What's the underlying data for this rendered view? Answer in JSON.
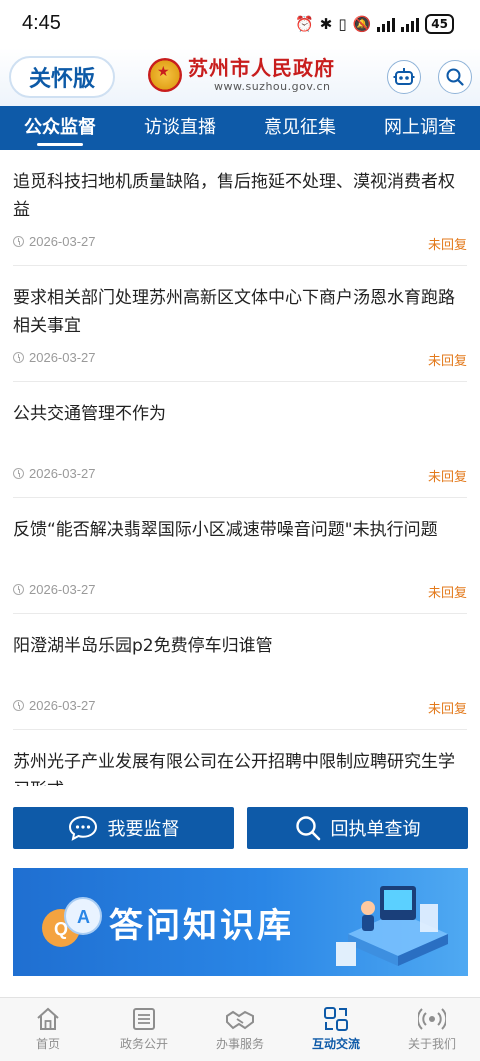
{
  "status_bar": {
    "time": "4:45",
    "battery": "45"
  },
  "header": {
    "care_label": "关怀版",
    "logo_cn": "苏州市人民政府",
    "logo_en": "www.suzhou.gov.cn"
  },
  "tabs": [
    {
      "label": "公众监督",
      "active": true
    },
    {
      "label": "访谈直播",
      "active": false
    },
    {
      "label": "意见征集",
      "active": false
    },
    {
      "label": "网上调查",
      "active": false
    }
  ],
  "items": [
    {
      "title": "追觅科技扫地机质量缺陷，售后拖延不处理、漠视消费者权益",
      "date": "2026-03-27",
      "status": "未回复"
    },
    {
      "title": "要求相关部门处理苏州高新区文体中心下商户汤恩水育跑路相关事宜",
      "date": "2026-03-27",
      "status": "未回复"
    },
    {
      "title": "公共交通管理不作为",
      "date": "2026-03-27",
      "status": "未回复"
    },
    {
      "title": "反馈“能否解决翡翠国际小区减速带噪音问题\"未执行问题",
      "date": "2026-03-27",
      "status": "未回复"
    },
    {
      "title": "阳澄湖半岛乐园p2免费停车归谁管",
      "date": "2026-03-27",
      "status": "未回复"
    },
    {
      "title": "苏州光子产业发展有限公司在公开招聘中限制应聘研究生学习形式",
      "date": "",
      "status": ""
    }
  ],
  "actions": {
    "supervise_label": "我要监督",
    "receipt_label": "回执单查询"
  },
  "banner": {
    "text": "答问知识库",
    "bubble_q": "Q",
    "bubble_a": "A"
  },
  "bottom_nav": [
    {
      "label": "首页",
      "icon": "home-icon"
    },
    {
      "label": "政务公开",
      "icon": "document-icon"
    },
    {
      "label": "办事服务",
      "icon": "handshake-icon"
    },
    {
      "label": "互动交流",
      "icon": "interaction-icon",
      "active": true
    },
    {
      "label": "关于我们",
      "icon": "broadcast-icon"
    }
  ],
  "colors": {
    "primary": "#0e5aa8",
    "status_orange": "#e37a1c",
    "brand_red": "#c81d1d"
  }
}
